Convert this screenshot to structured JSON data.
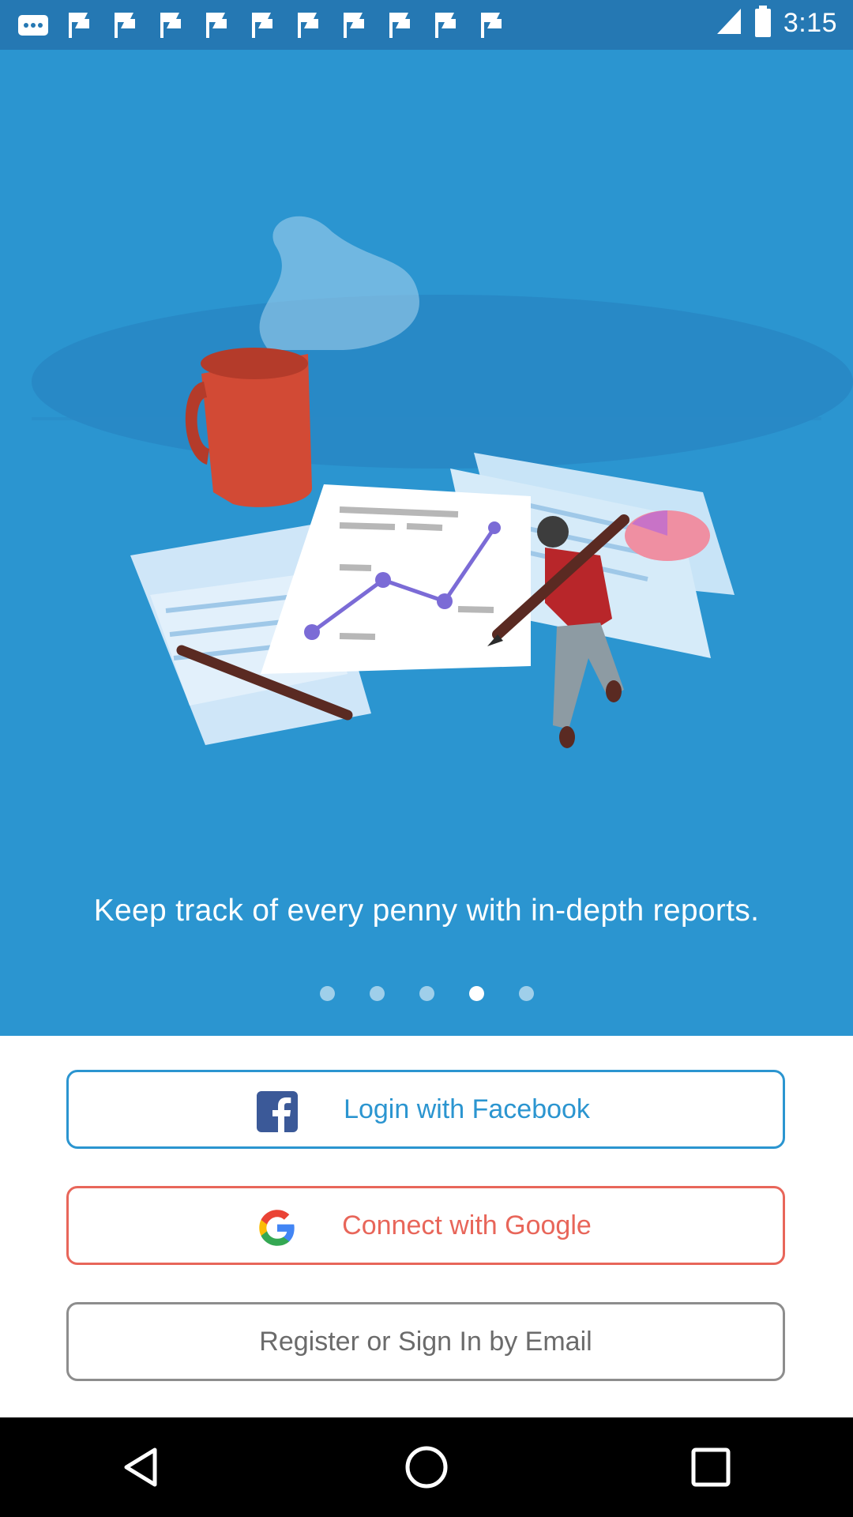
{
  "status_bar": {
    "time": "3:15",
    "notification_icons": [
      "more-icon",
      "flag-icon",
      "flag-icon",
      "flag-icon",
      "flag-icon",
      "flag-icon",
      "flag-icon",
      "flag-icon",
      "flag-icon",
      "flag-icon",
      "flag-icon"
    ],
    "battery_icon": "battery-icon",
    "signal_icon": "signal-icon"
  },
  "onboarding": {
    "illustration": "reports-illustration",
    "tagline": "Keep track of every penny with in-depth reports.",
    "pager": {
      "count": 5,
      "active_index": 3
    }
  },
  "auth": {
    "facebook_label": "Login with Facebook",
    "google_label": "Connect with Google",
    "email_label": "Register or Sign In by Email"
  },
  "colors": {
    "hero_background": "#2b95d0",
    "status_bar": "#2578b3",
    "facebook_accent": "#2b95d0",
    "google_accent": "#e8665a",
    "email_border": "#8d8d8d"
  },
  "nav": {
    "back_icon": "back-icon",
    "home_icon": "home-icon",
    "recents_icon": "recents-icon"
  }
}
